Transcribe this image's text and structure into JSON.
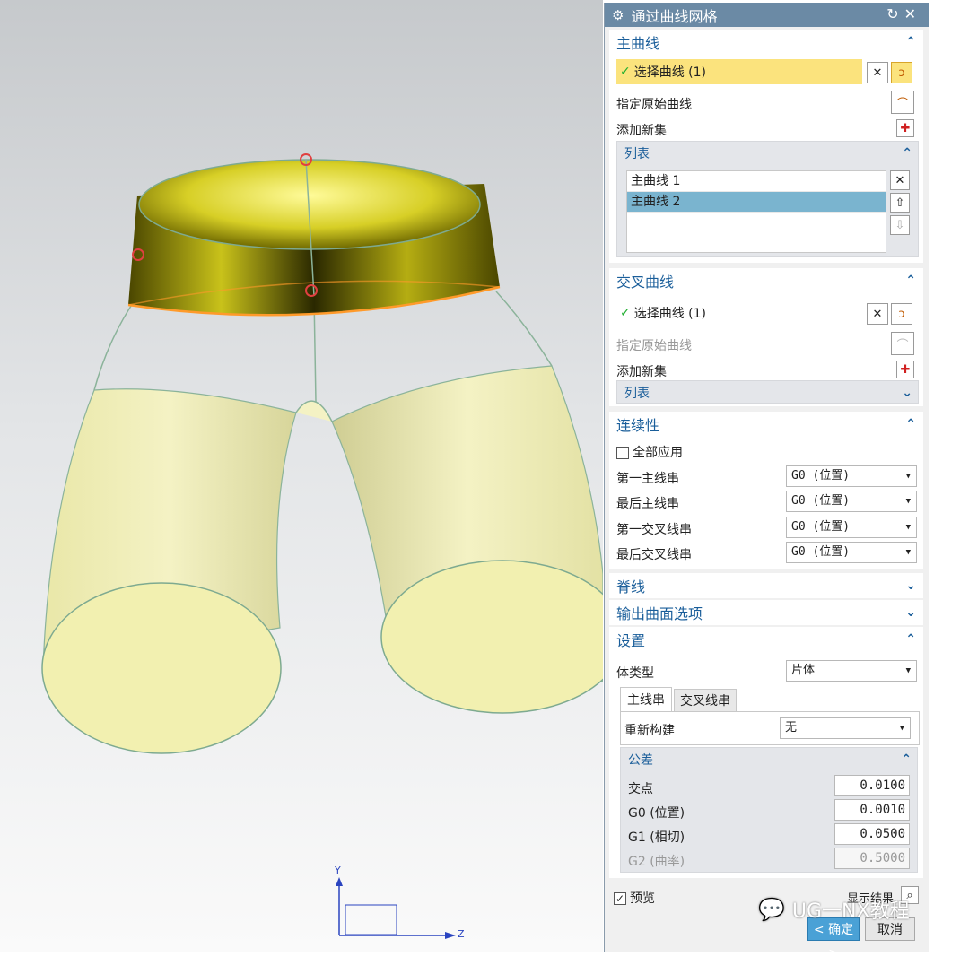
{
  "dialog": {
    "title": "通过曲线网格",
    "reset_icon": "reset-icon",
    "close_icon": "close-icon"
  },
  "primary": {
    "header": "主曲线",
    "select_label": "选择曲线 (1)",
    "specify_origin": "指定原始曲线",
    "add_new_set": "添加新集",
    "list_header": "列表",
    "items": [
      "主曲线 1",
      "主曲线 2"
    ]
  },
  "cross": {
    "header": "交叉曲线",
    "select_label": "选择曲线 (1)",
    "specify_origin": "指定原始曲线",
    "add_new_set": "添加新集",
    "list_header": "列表"
  },
  "continuity": {
    "header": "连续性",
    "apply_all": "全部应用",
    "rows": [
      {
        "label": "第一主线串",
        "value": "G0 (位置)"
      },
      {
        "label": "最后主线串",
        "value": "G0 (位置)"
      },
      {
        "label": "第一交叉线串",
        "value": "G0 (位置)"
      },
      {
        "label": "最后交叉线串",
        "value": "G0 (位置)"
      }
    ]
  },
  "spine": {
    "header": "脊线"
  },
  "output": {
    "header": "输出曲面选项"
  },
  "settings": {
    "header": "设置",
    "body_type_label": "体类型",
    "body_type_value": "片体",
    "tabs": [
      "主线串",
      "交叉线串"
    ],
    "rebuild_label": "重新构建",
    "rebuild_value": "无",
    "tolerance": {
      "header": "公差",
      "rows": [
        {
          "label": "交点",
          "value": "0.0100"
        },
        {
          "label": "G0 (位置)",
          "value": "0.0010"
        },
        {
          "label": "G1 (相切)",
          "value": "0.0500"
        },
        {
          "label": "G2 (曲率)",
          "value": "0.5000"
        }
      ]
    }
  },
  "footer": {
    "preview": "预览",
    "show_result": "显示结果",
    "ok": "< 确定 >",
    "cancel": "取消"
  },
  "watermark": "UG一NX教程",
  "axes": {
    "y": "Y",
    "z": "Z"
  }
}
